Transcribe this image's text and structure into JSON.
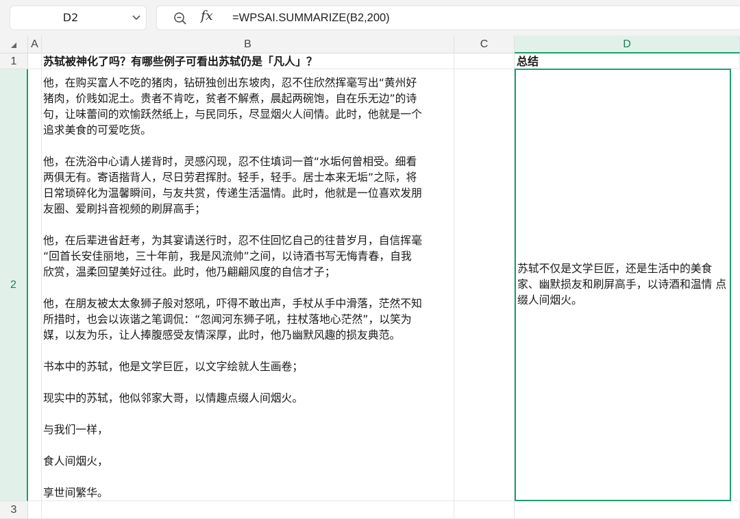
{
  "formula_bar": {
    "cell_ref": "D2",
    "formula": "=WPSAI.SUMMARIZE(B2,200)",
    "fx_label": "fx",
    "icons": [
      "zoom-icon",
      "fx-icon",
      "chevron-down-icon"
    ]
  },
  "columns": [
    "A",
    "B",
    "C",
    "D"
  ],
  "rows": [
    "1",
    "2",
    "3"
  ],
  "selected": {
    "column": "D",
    "row": "2"
  },
  "cells": {
    "B1": "苏轼被神化了吗？有哪些例子可看出苏轼仍是「凡人」？",
    "D1": "总结",
    "B2": "他，在购买富人不吃的猪肉，钻研独创出东坡肉，忍不住欣然挥毫写出“黄州好\n猪肉，价贱如泥土。贵者不肯吃，贫者不解煮，晨起两碗饱，自在乐无边”的诗\n句，让味蕾间的欢愉跃然纸上，与民同乐，尽显烟火人间情。此时，他就是一个\n追求美食的可爱吃货。\n\n他，在洗浴中心请人搓背时，灵感闪现，忍不住填词一首“水垢何曾相受。细看\n两俱无有。寄语揩背人，尽日劳君挥肘。轻手，轻手。居士本来无垢”之际，将\n日常琐碎化为温馨瞬间，与友共赏，传递生活温情。此时，他就是一位喜欢发朋\n友圈、爱刷抖音视频的刷屏高手；\n\n他，在后辈进省赶考，为其宴请送行时，忍不住回忆自己的往昔岁月，自信挥毫\n“回首长安佳丽地，三十年前，我是风流帅”之间，以诗酒书写无悔青春，自我\n欣赏，温柔回望美好过往。此时，他乃翩翩风度的自信才子；\n\n他，在朋友被太太象狮子般对怒吼，吓得不敢出声，手杖从手中滑落，茫然不知\n所措时，也会以诙谐之笔调侃：“忽闻河东狮子吼，拄杖落地心茫然”，以笑为\n媒，以友为乐，让人捧腹感受友情深厚，此时，他乃幽默风趣的损友典范。\n\n书本中的苏轼，他是文学巨匠，以文字绘就人生画卷；\n\n现实中的苏轼，他似邻家大哥，以情趣点缀人间烟火。\n\n与我们一样，\n\n食人间烟火，\n\n享世间繁华。",
    "D2": "苏轼不仅是文学巨匠，还是生活中的美食\n家、幽默损友和刷屏高手，以诗酒和温情\n点缀人间烟火。"
  },
  "colors": {
    "accent": "#1a9e6d",
    "header_bg": "#f3f3f3",
    "selected_header_bg": "#e1f1e9"
  }
}
